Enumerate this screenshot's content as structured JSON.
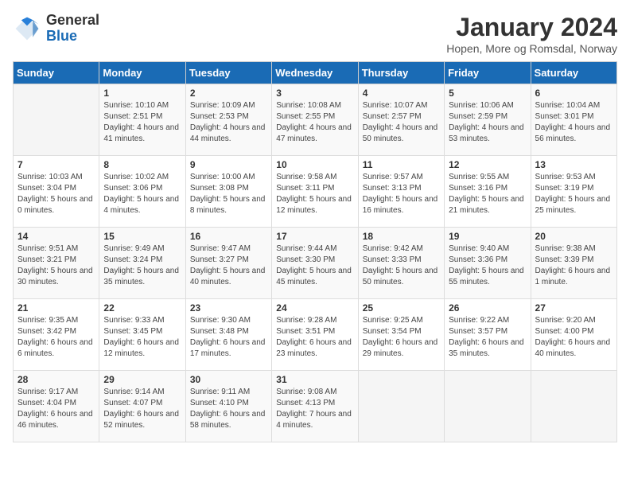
{
  "logo": {
    "general": "General",
    "blue": "Blue"
  },
  "header": {
    "title": "January 2024",
    "subtitle": "Hopen, More og Romsdal, Norway"
  },
  "days_of_week": [
    "Sunday",
    "Monday",
    "Tuesday",
    "Wednesday",
    "Thursday",
    "Friday",
    "Saturday"
  ],
  "weeks": [
    [
      {
        "day": null,
        "sunrise": null,
        "sunset": null,
        "daylight": null
      },
      {
        "day": "1",
        "sunrise": "Sunrise: 10:10 AM",
        "sunset": "Sunset: 2:51 PM",
        "daylight": "Daylight: 4 hours and 41 minutes."
      },
      {
        "day": "2",
        "sunrise": "Sunrise: 10:09 AM",
        "sunset": "Sunset: 2:53 PM",
        "daylight": "Daylight: 4 hours and 44 minutes."
      },
      {
        "day": "3",
        "sunrise": "Sunrise: 10:08 AM",
        "sunset": "Sunset: 2:55 PM",
        "daylight": "Daylight: 4 hours and 47 minutes."
      },
      {
        "day": "4",
        "sunrise": "Sunrise: 10:07 AM",
        "sunset": "Sunset: 2:57 PM",
        "daylight": "Daylight: 4 hours and 50 minutes."
      },
      {
        "day": "5",
        "sunrise": "Sunrise: 10:06 AM",
        "sunset": "Sunset: 2:59 PM",
        "daylight": "Daylight: 4 hours and 53 minutes."
      },
      {
        "day": "6",
        "sunrise": "Sunrise: 10:04 AM",
        "sunset": "Sunset: 3:01 PM",
        "daylight": "Daylight: 4 hours and 56 minutes."
      }
    ],
    [
      {
        "day": "7",
        "sunrise": "Sunrise: 10:03 AM",
        "sunset": "Sunset: 3:04 PM",
        "daylight": "Daylight: 5 hours and 0 minutes."
      },
      {
        "day": "8",
        "sunrise": "Sunrise: 10:02 AM",
        "sunset": "Sunset: 3:06 PM",
        "daylight": "Daylight: 5 hours and 4 minutes."
      },
      {
        "day": "9",
        "sunrise": "Sunrise: 10:00 AM",
        "sunset": "Sunset: 3:08 PM",
        "daylight": "Daylight: 5 hours and 8 minutes."
      },
      {
        "day": "10",
        "sunrise": "Sunrise: 9:58 AM",
        "sunset": "Sunset: 3:11 PM",
        "daylight": "Daylight: 5 hours and 12 minutes."
      },
      {
        "day": "11",
        "sunrise": "Sunrise: 9:57 AM",
        "sunset": "Sunset: 3:13 PM",
        "daylight": "Daylight: 5 hours and 16 minutes."
      },
      {
        "day": "12",
        "sunrise": "Sunrise: 9:55 AM",
        "sunset": "Sunset: 3:16 PM",
        "daylight": "Daylight: 5 hours and 21 minutes."
      },
      {
        "day": "13",
        "sunrise": "Sunrise: 9:53 AM",
        "sunset": "Sunset: 3:19 PM",
        "daylight": "Daylight: 5 hours and 25 minutes."
      }
    ],
    [
      {
        "day": "14",
        "sunrise": "Sunrise: 9:51 AM",
        "sunset": "Sunset: 3:21 PM",
        "daylight": "Daylight: 5 hours and 30 minutes."
      },
      {
        "day": "15",
        "sunrise": "Sunrise: 9:49 AM",
        "sunset": "Sunset: 3:24 PM",
        "daylight": "Daylight: 5 hours and 35 minutes."
      },
      {
        "day": "16",
        "sunrise": "Sunrise: 9:47 AM",
        "sunset": "Sunset: 3:27 PM",
        "daylight": "Daylight: 5 hours and 40 minutes."
      },
      {
        "day": "17",
        "sunrise": "Sunrise: 9:44 AM",
        "sunset": "Sunset: 3:30 PM",
        "daylight": "Daylight: 5 hours and 45 minutes."
      },
      {
        "day": "18",
        "sunrise": "Sunrise: 9:42 AM",
        "sunset": "Sunset: 3:33 PM",
        "daylight": "Daylight: 5 hours and 50 minutes."
      },
      {
        "day": "19",
        "sunrise": "Sunrise: 9:40 AM",
        "sunset": "Sunset: 3:36 PM",
        "daylight": "Daylight: 5 hours and 55 minutes."
      },
      {
        "day": "20",
        "sunrise": "Sunrise: 9:38 AM",
        "sunset": "Sunset: 3:39 PM",
        "daylight": "Daylight: 6 hours and 1 minute."
      }
    ],
    [
      {
        "day": "21",
        "sunrise": "Sunrise: 9:35 AM",
        "sunset": "Sunset: 3:42 PM",
        "daylight": "Daylight: 6 hours and 6 minutes."
      },
      {
        "day": "22",
        "sunrise": "Sunrise: 9:33 AM",
        "sunset": "Sunset: 3:45 PM",
        "daylight": "Daylight: 6 hours and 12 minutes."
      },
      {
        "day": "23",
        "sunrise": "Sunrise: 9:30 AM",
        "sunset": "Sunset: 3:48 PM",
        "daylight": "Daylight: 6 hours and 17 minutes."
      },
      {
        "day": "24",
        "sunrise": "Sunrise: 9:28 AM",
        "sunset": "Sunset: 3:51 PM",
        "daylight": "Daylight: 6 hours and 23 minutes."
      },
      {
        "day": "25",
        "sunrise": "Sunrise: 9:25 AM",
        "sunset": "Sunset: 3:54 PM",
        "daylight": "Daylight: 6 hours and 29 minutes."
      },
      {
        "day": "26",
        "sunrise": "Sunrise: 9:22 AM",
        "sunset": "Sunset: 3:57 PM",
        "daylight": "Daylight: 6 hours and 35 minutes."
      },
      {
        "day": "27",
        "sunrise": "Sunrise: 9:20 AM",
        "sunset": "Sunset: 4:00 PM",
        "daylight": "Daylight: 6 hours and 40 minutes."
      }
    ],
    [
      {
        "day": "28",
        "sunrise": "Sunrise: 9:17 AM",
        "sunset": "Sunset: 4:04 PM",
        "daylight": "Daylight: 6 hours and 46 minutes."
      },
      {
        "day": "29",
        "sunrise": "Sunrise: 9:14 AM",
        "sunset": "Sunset: 4:07 PM",
        "daylight": "Daylight: 6 hours and 52 minutes."
      },
      {
        "day": "30",
        "sunrise": "Sunrise: 9:11 AM",
        "sunset": "Sunset: 4:10 PM",
        "daylight": "Daylight: 6 hours and 58 minutes."
      },
      {
        "day": "31",
        "sunrise": "Sunrise: 9:08 AM",
        "sunset": "Sunset: 4:13 PM",
        "daylight": "Daylight: 7 hours and 4 minutes."
      },
      {
        "day": null,
        "sunrise": null,
        "sunset": null,
        "daylight": null
      },
      {
        "day": null,
        "sunrise": null,
        "sunset": null,
        "daylight": null
      },
      {
        "day": null,
        "sunrise": null,
        "sunset": null,
        "daylight": null
      }
    ]
  ]
}
